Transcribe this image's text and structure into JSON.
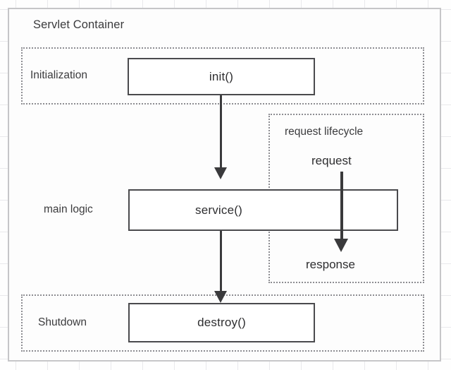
{
  "diagram": {
    "container_title": "Servlet Container",
    "phases": [
      {
        "id": "initialization",
        "label": "Initialization"
      },
      {
        "id": "main-logic",
        "label": "main logic"
      },
      {
        "id": "shutdown",
        "label": "Shutdown"
      },
      {
        "id": "request-lifecycle",
        "label": "request lifecycle"
      }
    ],
    "methods": [
      {
        "id": "init",
        "label": "init()"
      },
      {
        "id": "service",
        "label": "service()"
      },
      {
        "id": "destroy",
        "label": "destroy()"
      }
    ],
    "flow_labels": [
      {
        "id": "request",
        "label": "request"
      },
      {
        "id": "response",
        "label": "response"
      }
    ],
    "colors": {
      "container_border": "#c6c6c8",
      "dotted_border": "#8d8d92",
      "method_border": "#4a4a4d",
      "arrow": "#3a3a3c",
      "text": "#2e2e30",
      "grid": "#e9e9ec",
      "background": "#fefefe"
    }
  }
}
